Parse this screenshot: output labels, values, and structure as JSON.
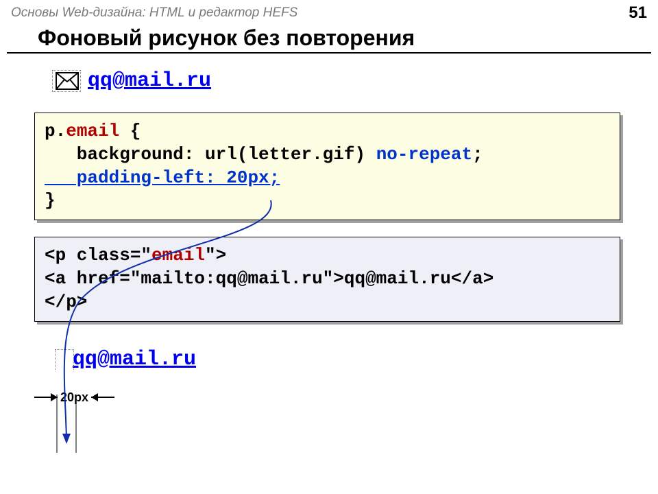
{
  "header": {
    "breadcrumb": "Основы Web-дизайна: HTML и редактор HEFS",
    "page_number": "51"
  },
  "title": "Фоновый рисунок без повторения",
  "demo1": {
    "email": "qq@mail.ru"
  },
  "css": {
    "l1_a": "p.",
    "l1_b": "email",
    "l1_c": " {",
    "l2_a": "   background: url(letter.gif) ",
    "l2_b": "no-repeat",
    "l2_c": ";",
    "l3": "   padding-left: 20px;",
    "l4": "}"
  },
  "html": {
    "l1_a": "<p class=\"",
    "l1_b": "email",
    "l1_c": "\">",
    "l2": "<a href=\"mailto:qq@mail.ru\">qq@mail.ru</a>",
    "l3": "</p>"
  },
  "demo2": {
    "email": "qq@mail.ru"
  },
  "dimension": {
    "label": "20px"
  }
}
